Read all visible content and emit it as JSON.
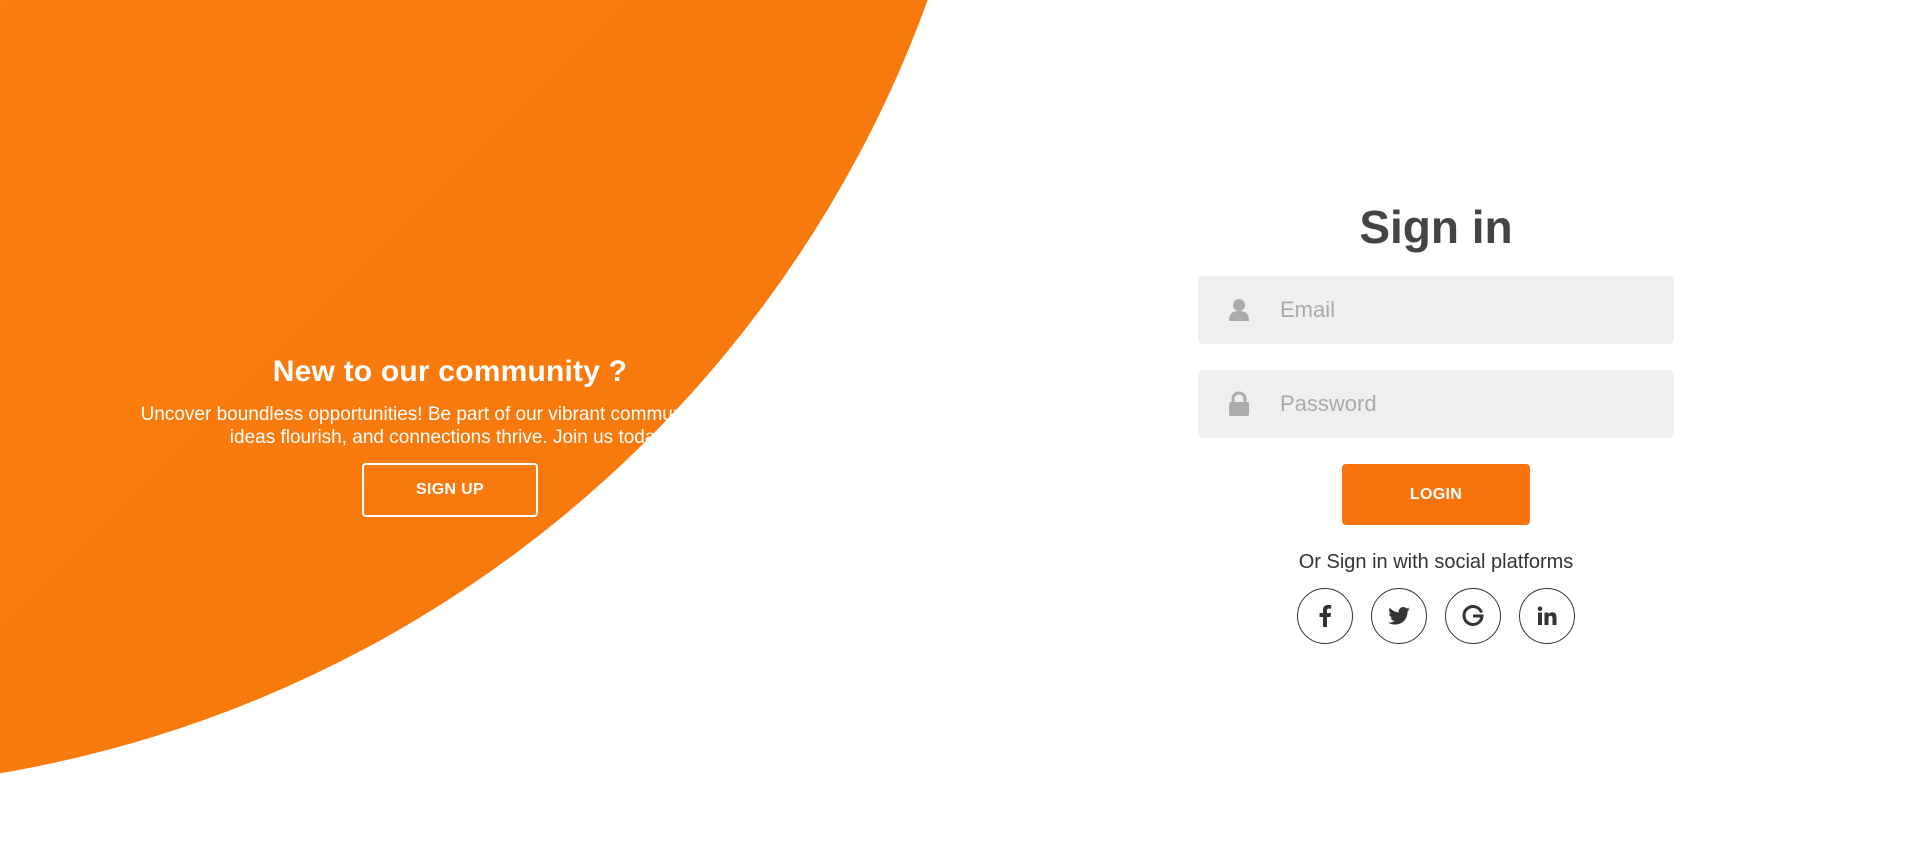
{
  "promo": {
    "title": "New to our community ?",
    "text": "Uncover boundless opportunities! Be part of our vibrant community where ideas flourish, and connections thrive. Join us today!",
    "signup_label": "SIGN UP"
  },
  "signin": {
    "title": "Sign in",
    "email_placeholder": "Email",
    "password_placeholder": "Password",
    "login_label": "LOGIN",
    "social_text": "Or Sign in with social platforms",
    "social": [
      {
        "name": "facebook-icon"
      },
      {
        "name": "twitter-icon"
      },
      {
        "name": "google-icon"
      },
      {
        "name": "linkedin-icon"
      }
    ]
  },
  "colors": {
    "accent": "#f7730b",
    "accent_light": "#ff8f14",
    "title_text": "#444444",
    "field_bg": "#efefef",
    "placeholder": "#aaaaaa"
  }
}
